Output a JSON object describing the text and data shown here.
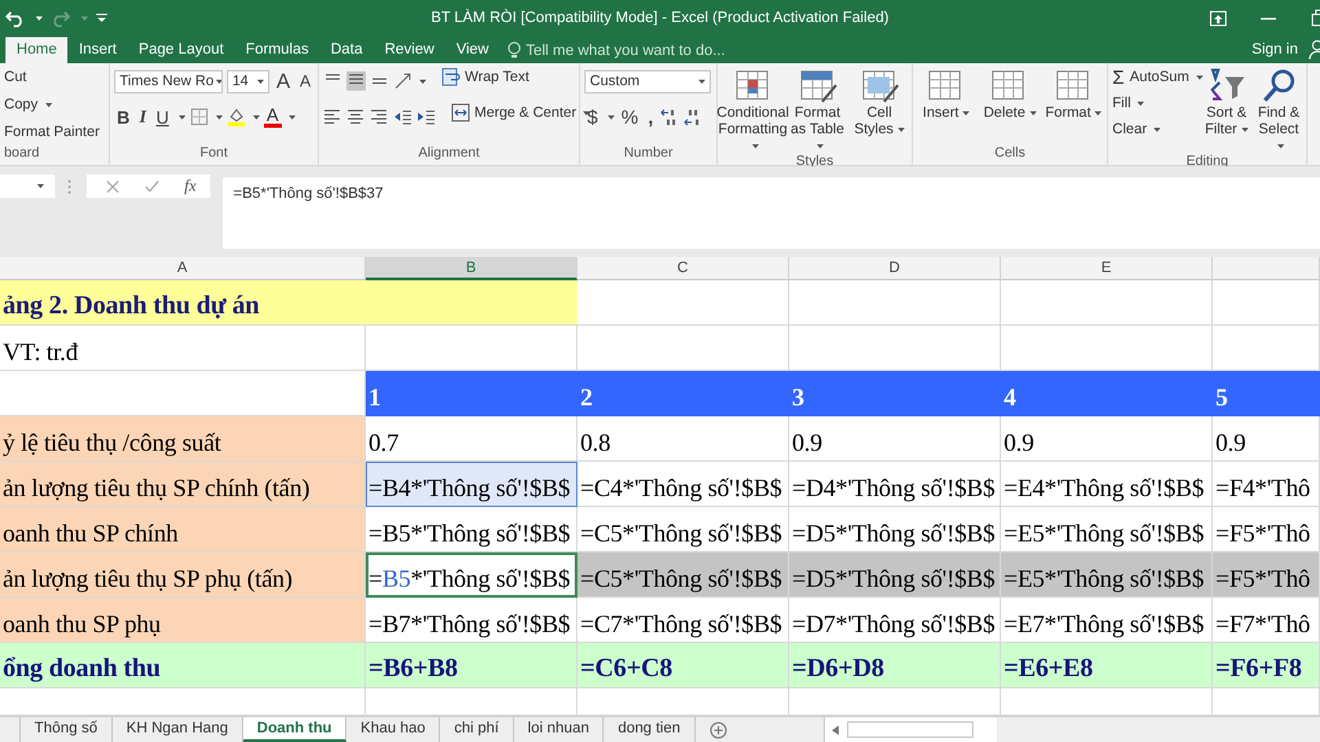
{
  "window": {
    "title": "BT LÀM RÒI  [Compatibility Mode] - Excel (Product Activation Failed)"
  },
  "tabs": [
    {
      "label": "Home",
      "selected": true
    },
    {
      "label": "Insert",
      "selected": false
    },
    {
      "label": "Page Layout",
      "selected": false
    },
    {
      "label": "Formulas",
      "selected": false
    },
    {
      "label": "Data",
      "selected": false
    },
    {
      "label": "Review",
      "selected": false
    },
    {
      "label": "View",
      "selected": false
    }
  ],
  "tell_me": {
    "placeholder": "Tell me what you want to do..."
  },
  "sign_in": "Sign in",
  "ribbon": [
    {
      "kind": "clipboard",
      "label": "board",
      "items": [
        {
          "label": "Cut",
          "dropdown": false
        },
        {
          "label": "Copy",
          "dropdown": true
        },
        {
          "label": "Format Painter",
          "dropdown": false
        }
      ]
    },
    {
      "kind": "font",
      "label": "Font",
      "font_name": "Times New Ro",
      "font_size": "14",
      "grow": "A",
      "shrink": "A",
      "bold": "B",
      "italic": "I",
      "underline": "U",
      "font_color": "A"
    },
    {
      "kind": "alignment",
      "label": "Alignment",
      "wrap": "Wrap Text",
      "merge": "Merge & Center"
    },
    {
      "kind": "number",
      "label": "Number",
      "format": "Custom",
      "currency": "$",
      "percent": "%",
      "comma": ","
    },
    {
      "kind": "large",
      "label": "Styles",
      "items": [
        {
          "label": "Conditional Formatting",
          "dropdown": true
        },
        {
          "label": "Format as Table",
          "dropdown": true
        },
        {
          "label": "Cell Styles",
          "dropdown": true
        }
      ]
    },
    {
      "kind": "large",
      "label": "Cells",
      "items": [
        {
          "label": "Insert",
          "dropdown": true
        },
        {
          "label": "Delete",
          "dropdown": true
        },
        {
          "label": "Format",
          "dropdown": true
        }
      ]
    },
    {
      "kind": "editing",
      "label": "Editing",
      "items": [
        {
          "label": "AutoSum",
          "symbol": "Σ",
          "dropdown": true
        },
        {
          "label": "Fill",
          "dropdown": true
        },
        {
          "label": "Clear",
          "dropdown": true
        }
      ],
      "large": [
        {
          "label": "Sort & Filter",
          "dropdown": true
        },
        {
          "label": "Find & Select",
          "dropdown": true
        }
      ]
    }
  ],
  "formula_bar": {
    "function_label": "fx",
    "formula": "=B5*'Thông số'!$B$37"
  },
  "columns": [
    {
      "label": "A",
      "selected": false
    },
    {
      "label": "B",
      "selected": true
    },
    {
      "label": "C",
      "selected": false
    },
    {
      "label": "D",
      "selected": false
    },
    {
      "label": "E",
      "selected": false
    }
  ],
  "rows": [
    {
      "cells": [
        {
          "text": "ảng 2. Doanh thu dự án",
          "kind": "title"
        },
        {
          "kind": "title"
        },
        {
          "kind": "plain"
        },
        {
          "kind": "plain"
        },
        {
          "kind": "plain"
        },
        {
          "kind": "plain"
        }
      ]
    },
    {
      "cells": [
        {
          "text": "VT: tr.đ",
          "kind": "plain"
        },
        {
          "kind": "plain"
        },
        {
          "kind": "plain"
        },
        {
          "kind": "plain"
        },
        {
          "kind": "plain"
        },
        {
          "kind": "plain"
        }
      ]
    },
    {
      "cells": [
        {
          "kind": "plain"
        },
        {
          "text": "1",
          "kind": "header"
        },
        {
          "text": "2",
          "kind": "header"
        },
        {
          "text": "3",
          "kind": "header"
        },
        {
          "text": "4",
          "kind": "header"
        },
        {
          "text": "5",
          "kind": "header"
        }
      ]
    },
    {
      "cells": [
        {
          "text": "ỷ lệ tiêu thụ /công suất",
          "kind": "label"
        },
        {
          "text": "0.7",
          "kind": "plain"
        },
        {
          "text": "0.8",
          "kind": "plain"
        },
        {
          "text": "0.9",
          "kind": "plain"
        },
        {
          "text": "0.9",
          "kind": "plain"
        },
        {
          "text": "0.9",
          "kind": "plain"
        }
      ]
    },
    {
      "cells": [
        {
          "text": "ản lượng tiêu thụ SP chính (tấn)",
          "kind": "label"
        },
        {
          "text": "=B4*'Thông số'!$B$",
          "kind": "ref"
        },
        {
          "text": "=C4*'Thông số'!$B$",
          "kind": "plain"
        },
        {
          "text": "=D4*'Thông số'!$B$",
          "kind": "plain"
        },
        {
          "text": "=E4*'Thông số'!$B$",
          "kind": "plain"
        },
        {
          "text": "=F4*'Thô",
          "kind": "plain"
        }
      ]
    },
    {
      "cells": [
        {
          "text": "oanh thu SP chính",
          "kind": "label"
        },
        {
          "text": "=B5*'Thông số'!$B$",
          "kind": "plain"
        },
        {
          "text": "=C5*'Thông số'!$B$",
          "kind": "plain"
        },
        {
          "text": "=D5*'Thông số'!$B$",
          "kind": "plain"
        },
        {
          "text": "=E5*'Thông số'!$B$",
          "kind": "plain"
        },
        {
          "text": "=F5*'Thô",
          "kind": "plain"
        }
      ]
    },
    {
      "cells": [
        {
          "text": "ản lượng tiêu thụ SP phụ (tấn)",
          "kind": "label"
        },
        {
          "kind": "editing",
          "segments": [
            {
              "text": "=",
              "kind": "plain"
            },
            {
              "text": "B5",
              "kind": "ref"
            },
            {
              "text": "*'Thông số'!$B$",
              "kind": "plain"
            }
          ]
        },
        {
          "text": "=C5*'Thông số'!$B$",
          "kind": "shaded"
        },
        {
          "text": "=D5*'Thông số'!$B$",
          "kind": "shaded"
        },
        {
          "text": "=E5*'Thông số'!$B$",
          "kind": "shaded"
        },
        {
          "text": "=F5*'Thô",
          "kind": "shaded"
        }
      ]
    },
    {
      "cells": [
        {
          "text": "oanh thu SP phụ",
          "kind": "label"
        },
        {
          "text": "=B7*'Thông số'!$B$",
          "kind": "plain"
        },
        {
          "text": "=C7*'Thông số'!$B$",
          "kind": "plain"
        },
        {
          "text": "=D7*'Thông số'!$B$",
          "kind": "plain"
        },
        {
          "text": "=E7*'Thông số'!$B$",
          "kind": "plain"
        },
        {
          "text": "=F7*'Thô",
          "kind": "plain"
        }
      ]
    },
    {
      "cells": [
        {
          "text": "ổng doanh thu",
          "kind": "total"
        },
        {
          "text": "=B6+B8",
          "kind": "total"
        },
        {
          "text": "=C6+C8",
          "kind": "total"
        },
        {
          "text": "=D6+D8",
          "kind": "total"
        },
        {
          "text": "=E6+E8",
          "kind": "total"
        },
        {
          "text": "=F6+F8",
          "kind": "total"
        }
      ]
    }
  ],
  "sheets": [
    {
      "label": "Thông số",
      "selected": false
    },
    {
      "label": "KH Ngan Hang",
      "selected": false
    },
    {
      "label": "Doanh thu",
      "selected": true
    },
    {
      "label": "Khau hao",
      "selected": false
    },
    {
      "label": "chi phí",
      "selected": false
    },
    {
      "label": "loi nhuan",
      "selected": false
    },
    {
      "label": "dong tien",
      "selected": false
    }
  ]
}
